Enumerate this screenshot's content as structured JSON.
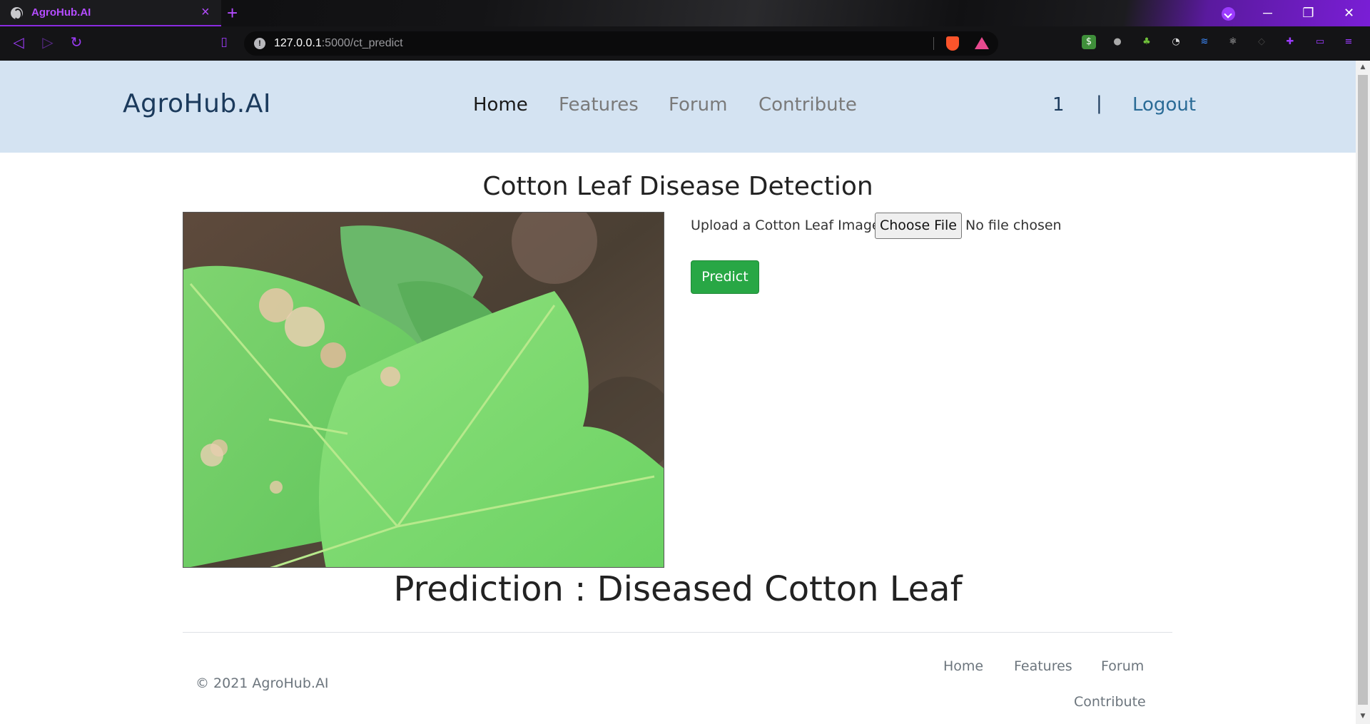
{
  "browser": {
    "tab_title": "AgroHub.AI",
    "tab_close": "×",
    "new_tab": "+",
    "url_host": "127.0.0.1",
    "url_rest": ":5000/ct_predict",
    "window_min": "─",
    "window_max": "❐",
    "window_close": "✕"
  },
  "header": {
    "brand": "AgroHub.AI",
    "nav": [
      {
        "label": "Home"
      },
      {
        "label": "Features"
      },
      {
        "label": "Forum"
      },
      {
        "label": "Contribute"
      }
    ],
    "user": "1",
    "divider": "|",
    "logout": "Logout"
  },
  "main": {
    "title": "Cotton Leaf Disease Detection",
    "upload_label": "Upload a Cotton Leaf Image:",
    "choose_file": "Choose File",
    "file_status": "No file chosen",
    "predict": "Predict",
    "prediction": "Prediction : Diseased Cotton Leaf"
  },
  "footer": {
    "copyright": "© 2021 AgroHub.AI",
    "links": [
      {
        "label": "Home"
      },
      {
        "label": "Features"
      },
      {
        "label": "Forum"
      },
      {
        "label": "Contribute"
      }
    ]
  },
  "colors": {
    "accent": "#8a2be2",
    "header_bg": "#d4e3f2",
    "predict_btn": "#28a745"
  },
  "icons": [
    "globe-icon",
    "back-icon",
    "forward-icon",
    "reload-icon",
    "bookmark-icon",
    "info-icon",
    "brave-shield-icon",
    "brave-rewards-icon",
    "extensions-icon",
    "wallet-icon",
    "menu-icon"
  ]
}
